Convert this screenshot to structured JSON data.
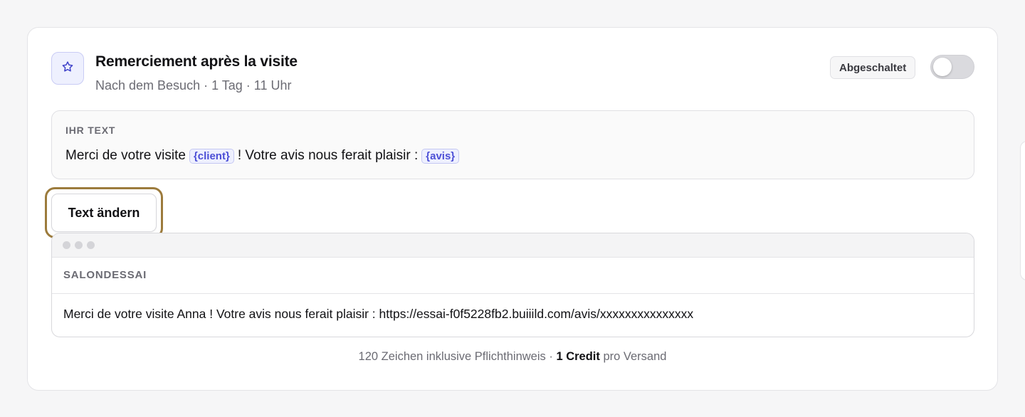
{
  "template": {
    "title": "Remerciement après la visite",
    "subtitle": "Nach dem Besuch · 1 Tag · 11 Uhr",
    "icon": "star-icon",
    "status_label": "Abgeschaltet",
    "toggle_enabled": false
  },
  "text_box": {
    "label": "IHR TEXT",
    "part1": "Merci de votre visite",
    "token1": "{client}",
    "part2": "! Votre avis nous ferait plaisir :",
    "token2": "{avis}"
  },
  "edit_button_label": "Text ändern",
  "preview": {
    "sender": "SALONDESSAI",
    "message": "Merci de votre visite Anna ! Votre avis nous ferait plaisir : https://essai-f0f5228fb2.buiiild.com/avis/xxxxxxxxxxxxxxx"
  },
  "footer": {
    "part1": "120 Zeichen inklusive Pflichthinweis ·",
    "credit": "1 Credit",
    "part2": "pro Versand"
  },
  "colors": {
    "accent": "#4c4fd6",
    "highlight_border": "#9c7b3c"
  }
}
